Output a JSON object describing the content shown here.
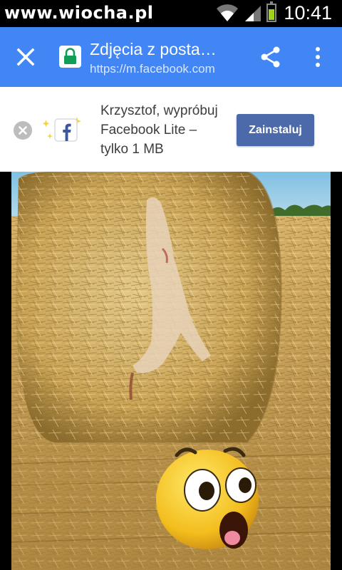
{
  "status_bar": {
    "watermark": "www.wiocha.pl",
    "time": "10:41",
    "battery_level": 0.7
  },
  "toolbar": {
    "title": "Zdjęcia z posta…",
    "url": "https://m.facebook.com"
  },
  "banner": {
    "message_line1": "Krzysztof, wypróbuj",
    "message_line2": "Facebook Lite –",
    "message_line3": "tylko 1 MB",
    "install_label": "Zainstaluj"
  },
  "colors": {
    "toolbar": "#4285f4",
    "install_button": "#4c6aa9",
    "lock_green": "#0f9d58",
    "battery": "#9ed31c"
  },
  "icons": [
    "close-icon",
    "lock-icon",
    "share-icon",
    "more-vert-icon",
    "dismiss-icon",
    "facebook-icon",
    "wifi-icon",
    "signal-icon",
    "battery-icon"
  ]
}
